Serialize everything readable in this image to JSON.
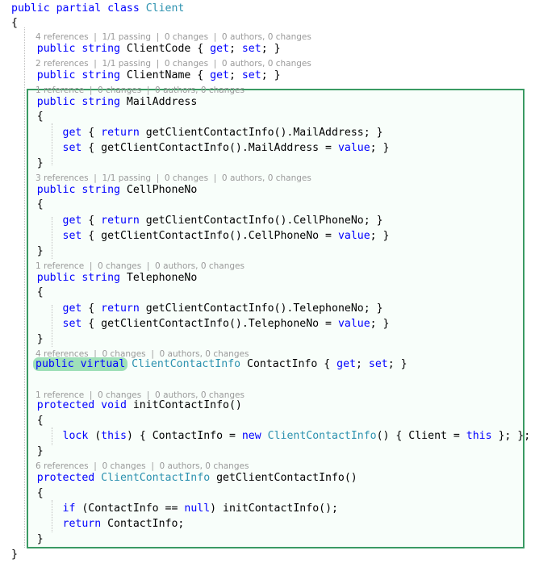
{
  "editor": {
    "app": "visual-studio-code-editor",
    "language": "csharp",
    "theme_background": "#ffffff",
    "accent_box_color": "#3a9a63",
    "inline_highlight_color": "#9fe0b9",
    "keyword_color": "#0000ff",
    "type_color": "#2b91af",
    "codelens_color": "#9a9a9a"
  },
  "codelens": {
    "client_code": "4 references  |  1/1 passing  |  0 changes  |  0 authors, 0 changes",
    "client_name": "2 references  |  1/1 passing  |  0 changes  |  0 authors, 0 changes",
    "mail_address": "1 reference  |  0 changes  |  0 authors, 0 changes",
    "cell_phone_no": "3 references  |  1/1 passing  |  0 changes  |  0 authors, 0 changes",
    "telephone_no": "1 reference  |  0 changes  |  0 authors, 0 changes",
    "contact_info": "4 references  |  0 changes  |  0 authors, 0 changes",
    "init_contact_info": "1 reference  |  0 changes  |  0 authors, 0 changes",
    "get_client_contact_info": "6 references  |  0 changes  |  0 authors, 0 changes"
  },
  "code": {
    "l01_a": "public partial class ",
    "l01_b": "Client",
    "l02": "{",
    "l04_a": "    public string ",
    "l04_b": "ClientCode { ",
    "l04_c": "get",
    "l04_d": "; ",
    "l04_e": "set",
    "l04_f": "; }",
    "l06_b": "ClientName { ",
    "l08_b": "MailAddress",
    "l09": "    {",
    "l10_a": "        get",
    "l10_b": " { ",
    "l10_c": "return",
    "l10_d": " getClientContactInfo().MailAddress; }",
    "l11_a": "        set",
    "l11_b": " { getClientContactInfo().MailAddress = ",
    "l11_c": "value",
    "l11_d": "; }",
    "l12": "    }",
    "l14_b": "CellPhoneNo",
    "l16_d": " getClientContactInfo().CellPhoneNo; }",
    "l17_b": " { getClientContactInfo().CellPhoneNo = ",
    "l20_b": "TelephoneNo",
    "l22_d": " getClientContactInfo().TelephoneNo; }",
    "l23_b": " { getClientContactInfo().TelephoneNo = ",
    "l26_hl": "public virtual",
    "l26_type": " ClientContactInfo ",
    "l26_rest": "ContactInfo { ",
    "l29_a": "    protected void ",
    "l29_b": "initContactInfo()",
    "l31_a": "        lock",
    "l31_b": " (",
    "l31_c": "this",
    "l31_d": ") { ContactInfo = ",
    "l31_e": "new",
    "l31_f": " ClientContactInfo",
    "l31_g": "() { Client = ",
    "l31_h": "this",
    "l31_i": " }; };",
    "l34_a": "    protected ",
    "l34_b": "ClientContactInfo",
    "l34_c": " getClientContactInfo()",
    "l36_a": "        if",
    "l36_b": " (ContactInfo == ",
    "l36_c": "null",
    "l36_d": ") initContactInfo();",
    "l37_a": "        return",
    "l37_b": " ContactInfo;",
    "l39": "}"
  }
}
